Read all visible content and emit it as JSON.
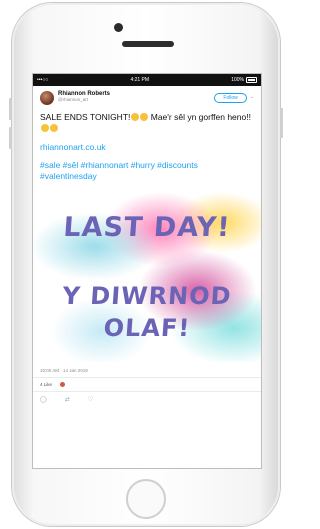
{
  "status_bar": {
    "carrier": "•••○○ ",
    "time": "4:21 PM",
    "battery": "100%"
  },
  "tweet": {
    "display_name": "Rhiannon Roberts",
    "handle": "@rhiannon_art",
    "follow_label": "Follow",
    "text": "SALE ENDS TONIGHT!",
    "text_cont": " Mae'r sêl yn gorffen heno!!",
    "link": "rhiannonart.co.uk",
    "hashtags": "#sale #sêl #rhiannonart #hurry #discounts #valentinesday",
    "image_text": {
      "line1": "LAST DAY!",
      "line2": "Y DIWRNOD",
      "line3": "OLAF!"
    },
    "timestamp": "10:00 AM · 14 Jan 2019",
    "likes": "4 Like"
  },
  "colors": {
    "accent": "#1da1f2",
    "image_text": "#6b63b5"
  }
}
